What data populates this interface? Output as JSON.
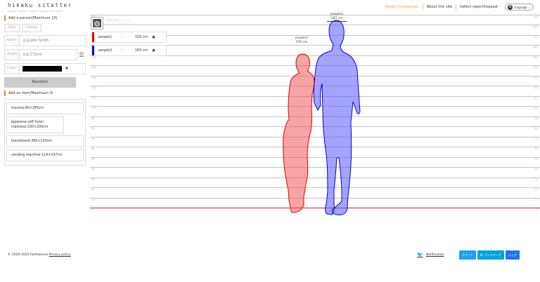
{
  "header": {
    "title": "hikaku sitatter",
    "subtitle": "hikaku sitatter - height comparison chart",
    "nav": [
      "Height Comparison",
      "About this site",
      "Defect report/request"
    ],
    "language_label": "language"
  },
  "sidebar": {
    "add_person_title": "Add a person(Maximum 10)",
    "sex_buttons": [
      "Male",
      "Female"
    ],
    "name_label": "Name",
    "name_placeholder": "e.g.John Smith",
    "height_label": "Height",
    "height_placeholder": "e.g.173cm",
    "color_label": "Colour",
    "color_value": "#000000",
    "random_label": "Random",
    "add_item_title": "Add an item(Maximum 3)",
    "items": [
      "fusuma:90×185cm",
      "Japanese soft futon mattress:100×200cm",
      "blackboard:360×120cm",
      "vending machine:114×197cm"
    ]
  },
  "chart": {
    "watermark_line1": "身長比較したった",
    "watermark_line2": "hikaku-sitatter.com",
    "unit": "cm",
    "people": [
      {
        "name": "people1",
        "height": 159,
        "height_label": "159",
        "unit": "cm",
        "color": "#e00000"
      },
      {
        "name": "people2",
        "height": 183,
        "height_label": "183",
        "unit": "cm",
        "color": "#0000cc"
      }
    ],
    "ticks": [
      190,
      180,
      170,
      160,
      150,
      140,
      130,
      120,
      110,
      100,
      90,
      80,
      70,
      60,
      50,
      40,
      30,
      20,
      10,
      0
    ]
  },
  "footer": {
    "copyright": "© 2020-2022 hot/hakono",
    "privacy": "Privacy policy",
    "notification": "Notification",
    "share_buttons": [
      {
        "label": "ツイート",
        "color": "#1da1f2"
      },
      {
        "label": "B! ブックマーク",
        "color": "#00a4de"
      },
      {
        "label": "シェア",
        "color": "#1877f2"
      }
    ]
  }
}
